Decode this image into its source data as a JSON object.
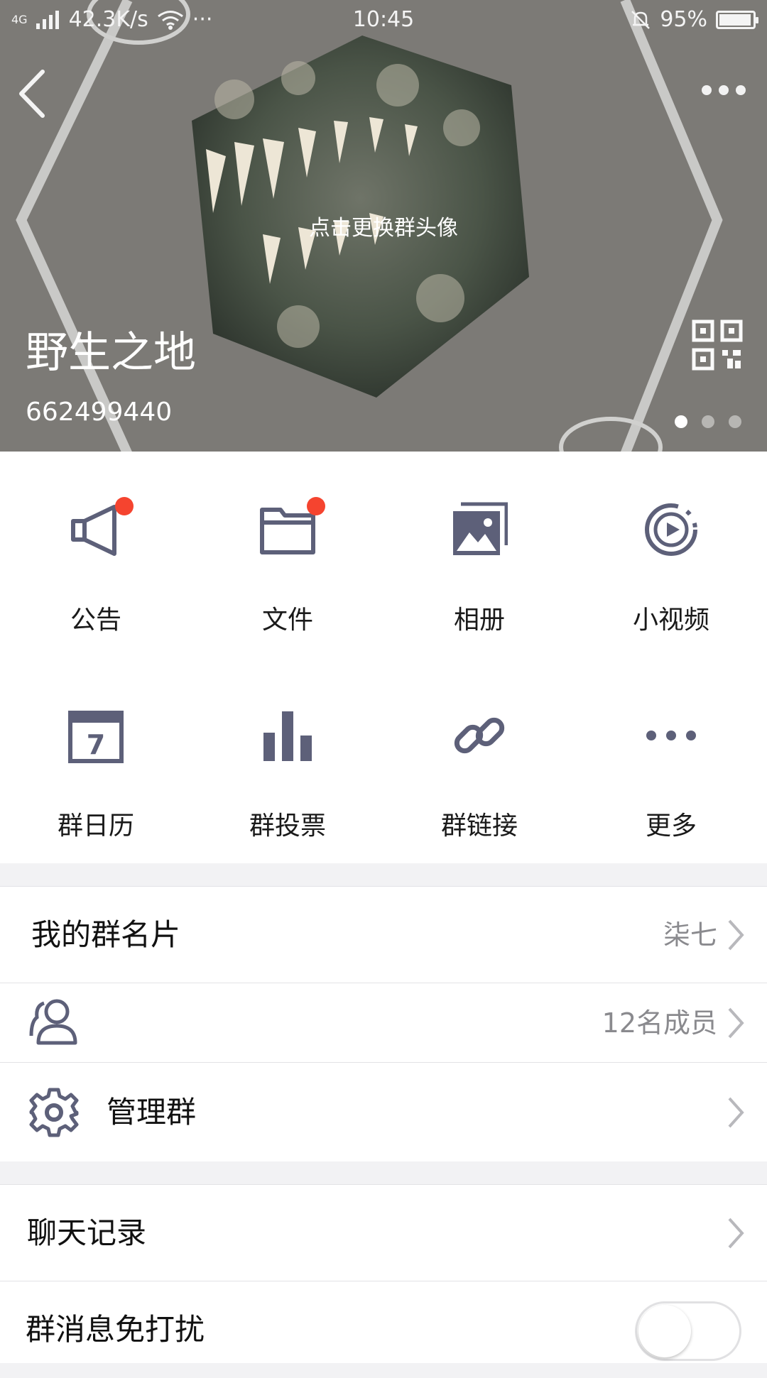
{
  "status_bar": {
    "network": "4G",
    "speed": "42.3K/s",
    "extra": "···",
    "time": "10:45",
    "battery": "95%",
    "battery_level": 0.95
  },
  "header": {
    "avatar_hint": "点击更换群头像",
    "group_name": "野生之地",
    "group_id": "662499440",
    "page_count": 3,
    "active_page": 1
  },
  "features": [
    {
      "label": "公告",
      "icon": "megaphone-icon",
      "badge": true
    },
    {
      "label": "文件",
      "icon": "folder-icon",
      "badge": true
    },
    {
      "label": "相册",
      "icon": "photo-album-icon",
      "badge": false
    },
    {
      "label": "小视频",
      "icon": "video-play-icon",
      "badge": false
    },
    {
      "label": "群日历",
      "icon": "calendar-icon",
      "badge": false,
      "calendar_day": "7"
    },
    {
      "label": "群投票",
      "icon": "bar-chart-icon",
      "badge": false
    },
    {
      "label": "群链接",
      "icon": "link-icon",
      "badge": false
    },
    {
      "label": "更多",
      "icon": "more-icon",
      "badge": false
    }
  ],
  "settings": {
    "card": {
      "label": "我的群名片",
      "value": "柒七"
    },
    "members": {
      "value": "12名成员"
    },
    "manage": {
      "label": "管理群"
    },
    "history": {
      "label": "聊天记录"
    },
    "mute": {
      "label": "群消息免打扰",
      "enabled": false
    }
  },
  "colors": {
    "icon": "#5d6079",
    "badge": "#f5442f",
    "section_bg": "#f2f2f4"
  }
}
